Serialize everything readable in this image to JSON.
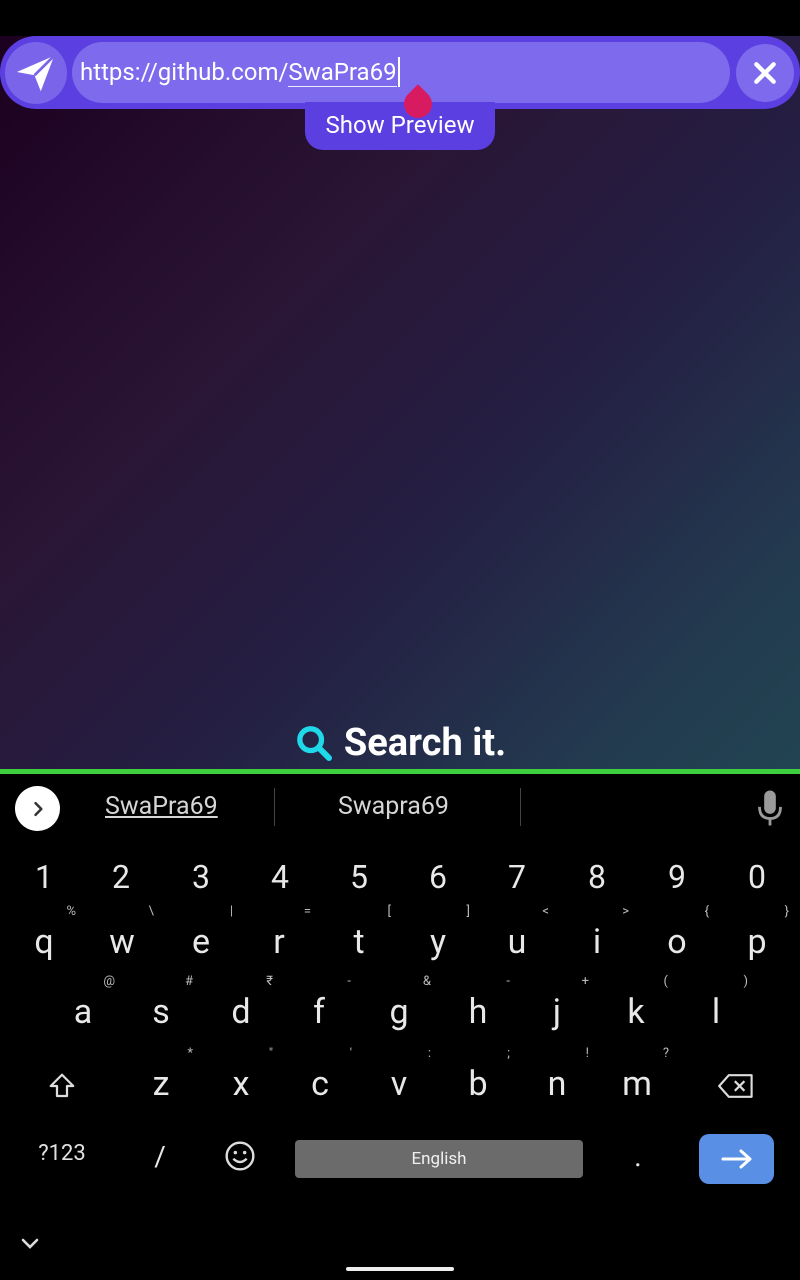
{
  "url_bar": {
    "url_prefix": "https://github.com/",
    "url_word": "SwaPra69",
    "preview_label": "Show Preview"
  },
  "main": {
    "title": "Search it."
  },
  "keyboard": {
    "suggestions": [
      "SwaPra69",
      "Swapra69"
    ],
    "number_row": [
      "1",
      "2",
      "3",
      "4",
      "5",
      "6",
      "7",
      "8",
      "9",
      "0"
    ],
    "row1": [
      [
        "q",
        "%"
      ],
      [
        "w",
        "\\"
      ],
      [
        "e",
        "|"
      ],
      [
        "r",
        "="
      ],
      [
        "t",
        "["
      ],
      [
        "y",
        "]"
      ],
      [
        "u",
        "<"
      ],
      [
        "i",
        ">"
      ],
      [
        "o",
        "{"
      ],
      [
        "p",
        "}"
      ]
    ],
    "row2": [
      [
        "a",
        "@"
      ],
      [
        "s",
        "#"
      ],
      [
        "d",
        "₹"
      ],
      [
        "f",
        "-"
      ],
      [
        "g",
        "&"
      ],
      [
        "h",
        "-"
      ],
      [
        "j",
        "+"
      ],
      [
        "k",
        "("
      ],
      [
        "l",
        ")"
      ]
    ],
    "row3": [
      [
        "z",
        "*"
      ],
      [
        "x",
        "\""
      ],
      [
        "c",
        "'"
      ],
      [
        "v",
        ":"
      ],
      [
        "b",
        ";"
      ],
      [
        "n",
        "!"
      ],
      [
        "m",
        "?"
      ]
    ],
    "symbols_label": "?123",
    "slash_label": "/",
    "space_label": "English",
    "period_label": "."
  },
  "colors": {
    "accent": "#5b3fe0",
    "selection_handle": "#d81b60",
    "search_icon": "#1fd8e8",
    "keyboard_divider": "#3ecf3e",
    "enter_key": "#5a8fe6"
  }
}
